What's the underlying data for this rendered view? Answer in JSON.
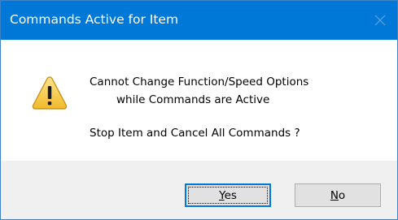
{
  "window": {
    "title": "Commands Active for Item",
    "title_bar_color": "#0078d7",
    "close_icon": "close-icon"
  },
  "message": {
    "icon": "warning-icon",
    "line1": "Cannot Change Function/Speed Options",
    "line2": "while Commands are Active",
    "line3": "Stop Item and Cancel All Commands ?"
  },
  "buttons": {
    "yes_label": "Yes",
    "no_label": "No"
  }
}
